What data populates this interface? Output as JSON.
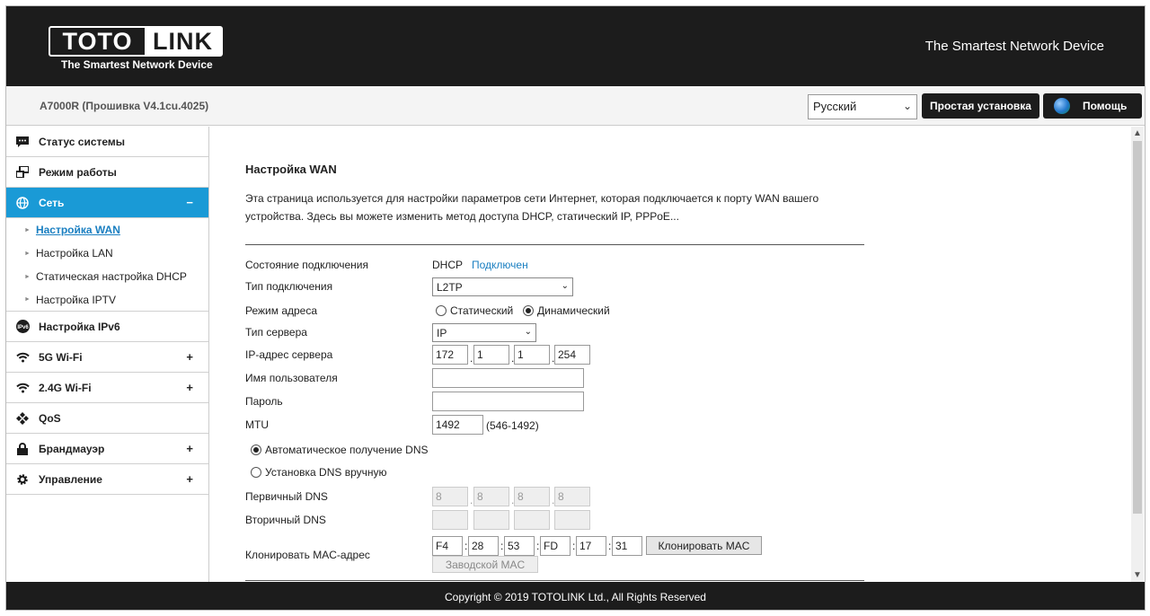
{
  "header": {
    "logo_left": "TOTO",
    "logo_right": "LINK",
    "logo_tagline": "The Smartest Network Device",
    "tagline_right": "The Smartest Network Device"
  },
  "topbar": {
    "model": "A7000R (Прошивка V4.1cu.4025)",
    "language": "Русский",
    "easy_setup": "Простая установка",
    "help": "Помощь"
  },
  "sidebar": {
    "items": [
      {
        "label": "Статус системы",
        "icon": "chat-icon"
      },
      {
        "label": "Режим работы",
        "icon": "mode-icon"
      },
      {
        "label": "Сеть",
        "icon": "globe-icon",
        "toggle": "−"
      },
      {
        "label": "Настройка IPv6",
        "icon": "ipv6-icon"
      },
      {
        "label": "5G Wi-Fi",
        "icon": "wifi-icon",
        "toggle": "+"
      },
      {
        "label": "2.4G Wi-Fi",
        "icon": "wifi-icon",
        "toggle": "+"
      },
      {
        "label": "QoS",
        "icon": "qos-icon"
      },
      {
        "label": "Брандмауэр",
        "icon": "lock-icon",
        "toggle": "+"
      },
      {
        "label": "Управление",
        "icon": "gear-icon",
        "toggle": "+"
      }
    ],
    "network_sub": [
      "Настройка WAN",
      "Настройка LAN",
      "Статическая настройка DHCP",
      "Настройка IPTV"
    ]
  },
  "content": {
    "title": "Настройка WAN",
    "description": "Эта страница используется для настройки параметров сети Интернет, которая подключается к порту WAN вашего устройства. Здесь вы можете изменить метод доступа DHCP, статический IP, PPPoE...",
    "status_label": "Состояние подключения",
    "status_proto": "DHCP",
    "status_state": "Подключен",
    "conn_type_label": "Тип подключения",
    "conn_type": "L2TP",
    "addr_mode_label": "Режим адреса",
    "addr_static": "Статический",
    "addr_dynamic": "Динамический",
    "server_type_label": "Тип сервера",
    "server_type": "IP",
    "server_ip_label": "IP-адрес сервера",
    "server_ip": [
      "172",
      "1",
      "1",
      "254"
    ],
    "username_label": "Имя пользователя",
    "username": "",
    "password_label": "Пароль",
    "password": "",
    "mtu_label": "MTU",
    "mtu": "1492",
    "mtu_range": "(546-1492)",
    "dns_auto": "Автоматическое получение DNS",
    "dns_manual": "Установка DNS вручную",
    "dns1_label": "Первичный DNS",
    "dns1": [
      "8",
      "8",
      "8",
      "8"
    ],
    "dns2_label": "Вторичный DNS",
    "dns2": [
      "",
      "",
      "",
      ""
    ],
    "mac_label": "Клонировать MAC-адрес",
    "mac": [
      "F4",
      "28",
      "53",
      "FD",
      "17",
      "31"
    ],
    "clone_mac_btn": "Клонировать MAC",
    "factory_mac_btn": "Заводской MAC"
  },
  "footer": {
    "copyright": "Copyright © 2019 TOTOLINK Ltd., All Rights Reserved"
  }
}
